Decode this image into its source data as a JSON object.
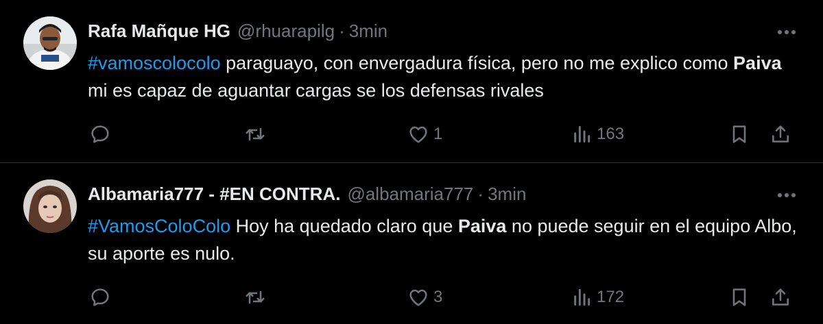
{
  "tweets": [
    {
      "name": "Rafa Mañque HG",
      "handle": "@rhuarapilg",
      "separator": "·",
      "time": "3min",
      "text": {
        "hashtag": "#vamoscolocolo",
        "part1": " paraguayo, con envergadura física, pero no me explico como ",
        "bold": "Paiva",
        "part2": " mi es capaz de aguantar cargas se los defensas rivales"
      },
      "likes": "1",
      "views": "163"
    },
    {
      "name": "Albamaria777 - #EN CONTRA.",
      "handle": "@albamaria777",
      "separator": "·",
      "time": "3min",
      "text": {
        "hashtag": "#VamosColoColo",
        "part1": " Hoy ha quedado claro que ",
        "bold": "Paiva",
        "part2": " no puede seguir en el equipo Albo, su aporte es nulo."
      },
      "likes": "3",
      "views": "172"
    }
  ],
  "icons": [
    "reply-icon",
    "retweet-icon",
    "like-icon",
    "views-icon",
    "bookmark-icon",
    "share-icon",
    "more-icon"
  ],
  "colors": {
    "background": "#000000",
    "text": "#e7e9ea",
    "muted": "#71767b",
    "hashtag": "#1d9bf0",
    "divider": "#2f3336"
  }
}
